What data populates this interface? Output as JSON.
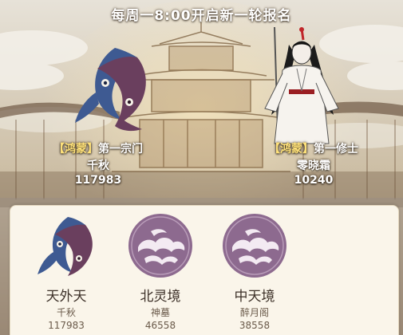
{
  "banner": {
    "text": "每周一8:00开启新一轮报名"
  },
  "champions": {
    "sect": {
      "tag": "【鸿蒙】",
      "title": "第一宗门",
      "name": "千秋",
      "score": "117983"
    },
    "cultivator": {
      "tag": "【鸿蒙】",
      "title": "第一修士",
      "name": "零晓霜",
      "score": "10240"
    }
  },
  "realms": [
    {
      "realm": "天外天",
      "leader": "千秋",
      "score": "117983",
      "emblem": "koi-fish-icon"
    },
    {
      "realm": "北灵境",
      "leader": "神墓",
      "score": "46558",
      "emblem": "cloud-seal-icon"
    },
    {
      "realm": "中天境",
      "leader": "醉月阁",
      "score": "38558",
      "emblem": "cloud-seal-icon"
    }
  ],
  "colors": {
    "banner_text": "#ffffff",
    "tag_gold": "#ffe27a",
    "panel_bg": "#faf5ea",
    "seal_purple": "#8d6a8f"
  }
}
